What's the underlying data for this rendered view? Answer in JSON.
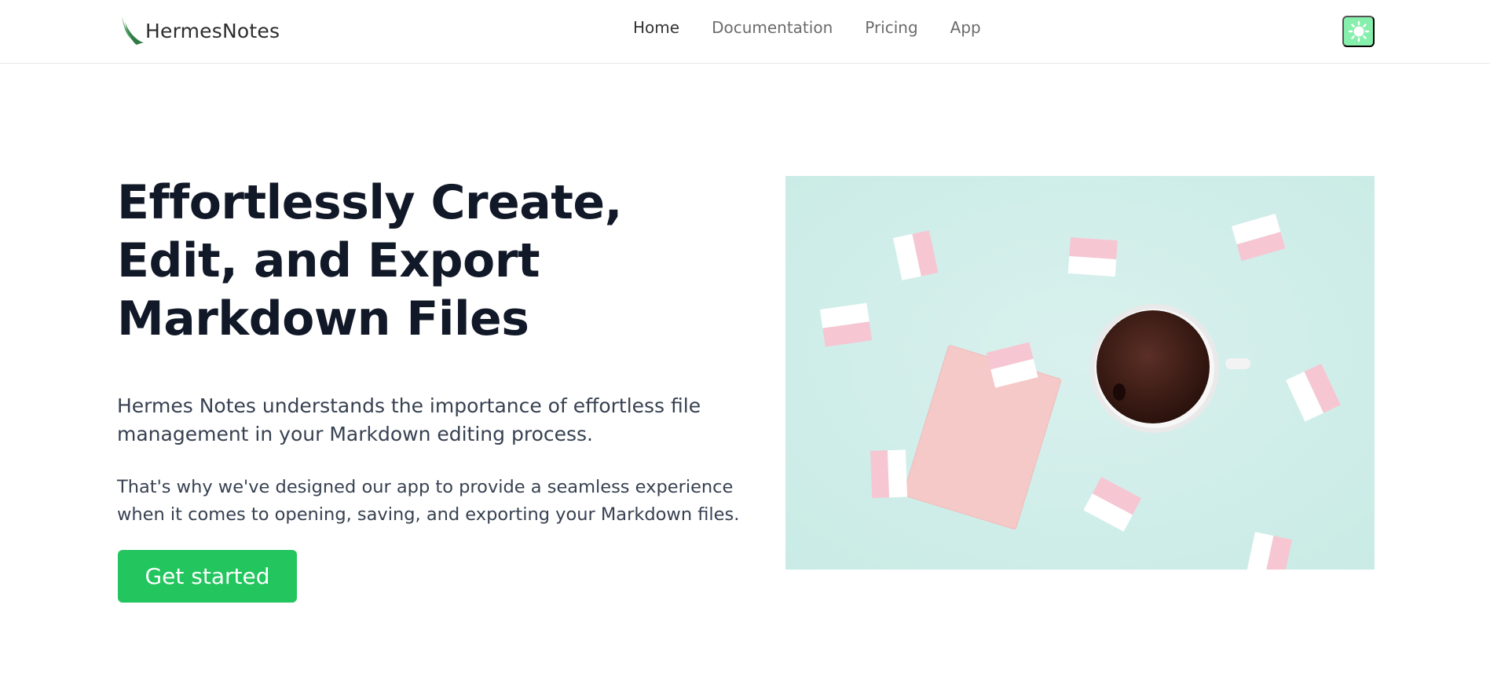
{
  "brand": {
    "name": "HermesNotes",
    "accent": "#22c55e",
    "theme_button_color": "#86efac"
  },
  "nav": {
    "items": [
      {
        "label": "Home",
        "active": true
      },
      {
        "label": "Documentation",
        "active": false
      },
      {
        "label": "Pricing",
        "active": false
      },
      {
        "label": "App",
        "active": false
      }
    ]
  },
  "header": {
    "theme_toggle_icon": "sun-icon"
  },
  "hero": {
    "title": "Effortlessly Create, Edit, and Export Markdown Files",
    "paragraph1": "Hermes Notes understands the importance of effortless file management in your Markdown editing process.",
    "paragraph2": "That's why we've designed our app to provide a seamless experience when it comes to opening, saving, and exporting your Markdown files.",
    "cta_label": "Get started",
    "image_subject": "coffee cup, marshmallows and a pink card on a mint background"
  }
}
